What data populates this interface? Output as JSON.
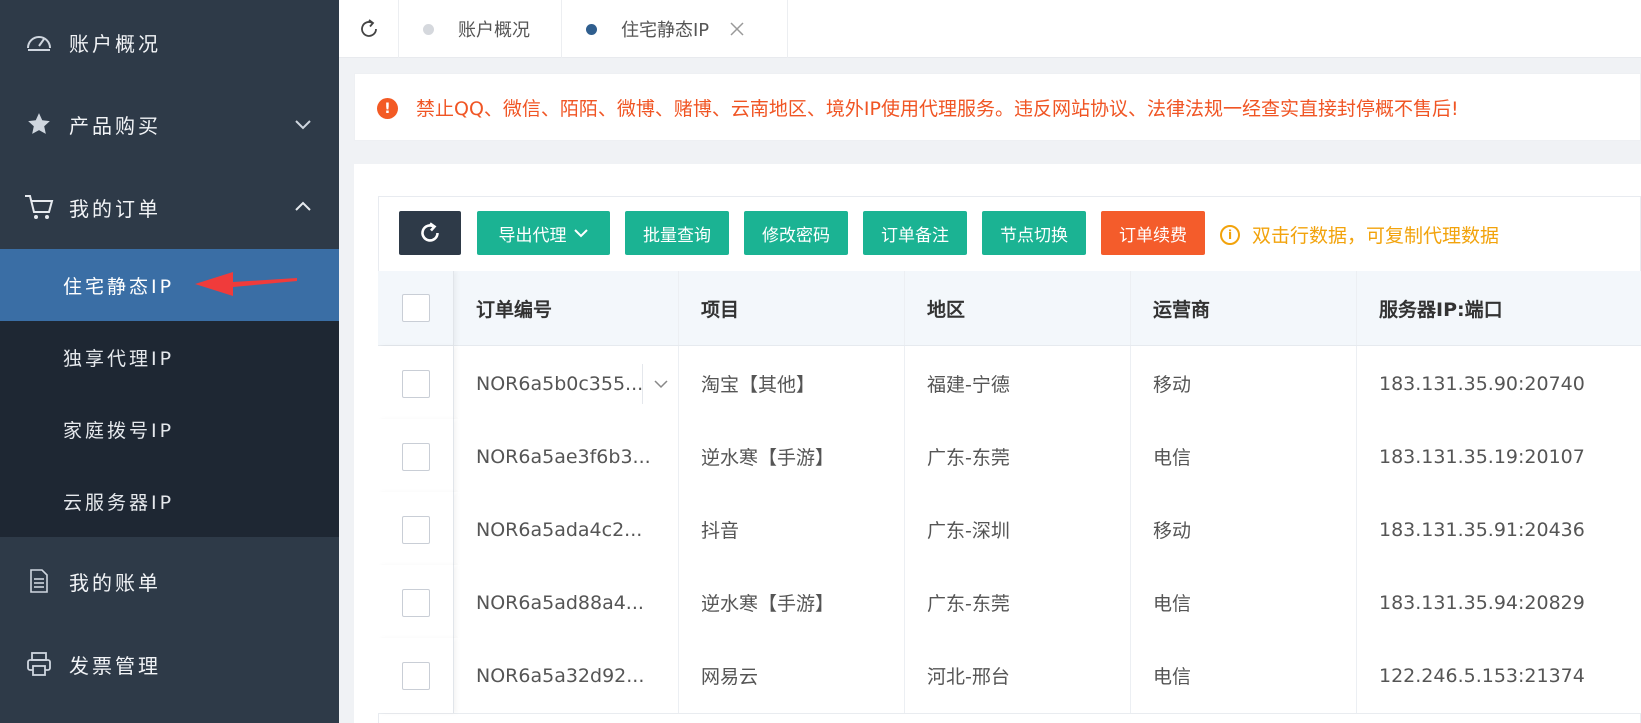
{
  "sidebar": {
    "items": [
      {
        "label": "账户概况",
        "icon": "dashboard-icon"
      },
      {
        "label": "产品购买",
        "icon": "star-icon"
      },
      {
        "label": "我的订单",
        "icon": "cart-icon"
      },
      {
        "label": "我的账单",
        "icon": "document-icon"
      },
      {
        "label": "发票管理",
        "icon": "printer-icon"
      }
    ],
    "submenu": [
      {
        "label": "住宅静态IP"
      },
      {
        "label": "独享代理IP"
      },
      {
        "label": "家庭拨号IP"
      },
      {
        "label": "云服务器IP"
      }
    ],
    "active": "住宅静态IP"
  },
  "tabs": [
    {
      "label": "账户概况"
    },
    {
      "label": "住宅静态IP"
    }
  ],
  "notice": {
    "text": "禁止QQ、微信、陌陌、微博、赌博、云南地区、境外IP使用代理服务。违反网站协议、法律法规一经查实直接封停概不售后!"
  },
  "toolbar": {
    "export": "导出代理",
    "batch": "批量查询",
    "change_password": "修改密码",
    "order_note": "订单备注",
    "switch_node": "节点切换",
    "renew": "订单续费",
    "hint": "双击行数据，可复制代理数据"
  },
  "table": {
    "headers": [
      "订单编号",
      "项目",
      "地区",
      "运营商",
      "服务器IP:端口"
    ],
    "rows": [
      {
        "id": "NOR6a5b0c355...",
        "item": "淘宝【其他】",
        "region": "福建-宁德",
        "operator": "移动",
        "ip": "183.131.35.90:20740"
      },
      {
        "id": "NOR6a5ae3f6b3...",
        "item": "逆水寒【手游】",
        "region": "广东-东莞",
        "operator": "电信",
        "ip": "183.131.35.19:20107"
      },
      {
        "id": "NOR6a5ada4c2...",
        "item": "抖音",
        "region": "广东-深圳",
        "operator": "移动",
        "ip": "183.131.35.91:20436"
      },
      {
        "id": "NOR6a5ad88a4...",
        "item": "逆水寒【手游】",
        "region": "广东-东莞",
        "operator": "电信",
        "ip": "183.131.35.94:20829"
      },
      {
        "id": "NOR6a5a32d92...",
        "item": "网易云",
        "region": "河北-邢台",
        "operator": "电信",
        "ip": "122.246.5.153:21374"
      }
    ]
  },
  "colors": {
    "sidebar_bg": "#2e3a48",
    "submenu_bg": "#1e2733",
    "active_bg": "#3a6ea5",
    "teal": "#1bb393",
    "orange": "#f45c2b",
    "warning": "#f05524",
    "hint": "#f2a30c"
  }
}
